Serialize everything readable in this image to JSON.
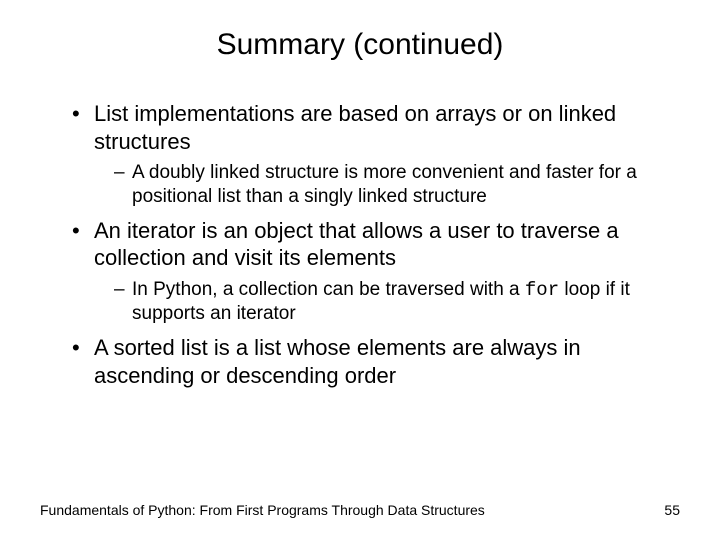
{
  "title": "Summary (continued)",
  "bullets": [
    {
      "text": "List implementations are based on arrays or on linked structures",
      "subs": [
        {
          "text": "A doubly linked structure is more convenient and faster for a positional list than a singly linked structure"
        }
      ]
    },
    {
      "text": "An iterator is an object that allows a user to traverse a collection and visit its elements",
      "subs": [
        {
          "prefix": "In Python, a collection can be traversed with a ",
          "code": "for",
          "suffix": " loop if it supports an iterator"
        }
      ]
    },
    {
      "text": "A sorted list is a list whose elements are always in ascending or descending order",
      "subs": []
    }
  ],
  "footer": {
    "left": "Fundamentals of Python: From First Programs Through Data Structures",
    "right": "55"
  }
}
